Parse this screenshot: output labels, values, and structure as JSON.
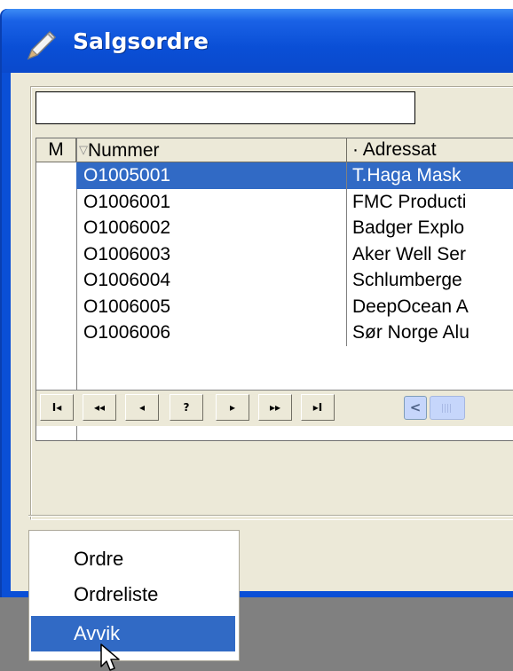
{
  "window": {
    "title": "Salgsordre"
  },
  "search": {
    "value": ""
  },
  "grid": {
    "columns": [
      {
        "label": "M"
      },
      {
        "label": "Nummer",
        "sort": "descending"
      },
      {
        "label": "Adressat",
        "prefix": "·"
      }
    ],
    "rows": [
      {
        "nummer": "O1005001",
        "adressat": "T.Haga Mask",
        "selected": true
      },
      {
        "nummer": "O1006001",
        "adressat": "FMC Producti"
      },
      {
        "nummer": "O1006002",
        "adressat": "Badger Explo"
      },
      {
        "nummer": "O1006003",
        "adressat": "Aker Well Ser"
      },
      {
        "nummer": "O1006004",
        "adressat": "Schlumberge"
      },
      {
        "nummer": "O1006005",
        "adressat": "DeepOcean A"
      },
      {
        "nummer": "O1006006",
        "adressat": "Sør Norge Alu"
      }
    ]
  },
  "navigator": {
    "first": "I◂",
    "prev_page": "◂◂",
    "prev": "◂",
    "find": "?",
    "next": "▸",
    "next_page": "▸▸",
    "last": "▸I"
  },
  "scrollbar": {
    "left_arrow": "<"
  },
  "context_menu": {
    "items": [
      {
        "label": "Ordre"
      },
      {
        "label": "Ordreliste"
      },
      {
        "label": "Avvik",
        "highlighted": true
      }
    ]
  },
  "colors": {
    "title_bar": "#0a4fd6",
    "selection": "#316ac5",
    "window_bg": "#ece9d8"
  }
}
